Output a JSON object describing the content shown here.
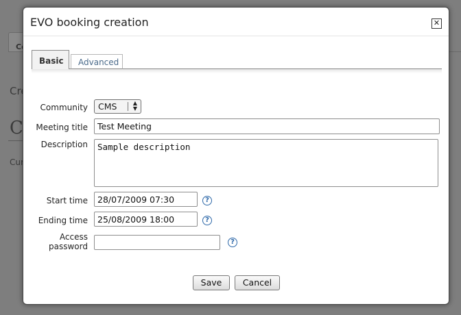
{
  "background": {
    "tab_label": "Co",
    "text1": "Cre",
    "text2": "C",
    "text3": "Cur"
  },
  "dialog": {
    "title": "EVO booking creation",
    "close_label": "✕",
    "tabs": [
      {
        "label": "Basic",
        "active": true
      },
      {
        "label": "Advanced",
        "active": false
      }
    ],
    "fields": {
      "community": {
        "label": "Community",
        "value": "CMS"
      },
      "meeting_title": {
        "label": "Meeting title",
        "value": "Test Meeting"
      },
      "description": {
        "label": "Description",
        "value": "Sample description"
      },
      "start_time": {
        "label": "Start time",
        "value": "28/07/2009 07:30"
      },
      "ending_time": {
        "label": "Ending time",
        "value": "25/08/2009 18:00"
      },
      "access_password": {
        "label_line1": "Access",
        "label_line2": "password",
        "value": ""
      }
    },
    "help_glyph": "?",
    "buttons": {
      "save": "Save",
      "cancel": "Cancel"
    }
  },
  "colors": {
    "help_icon": "#2c67a8",
    "tab_inactive_text": "#4a6a8a"
  }
}
